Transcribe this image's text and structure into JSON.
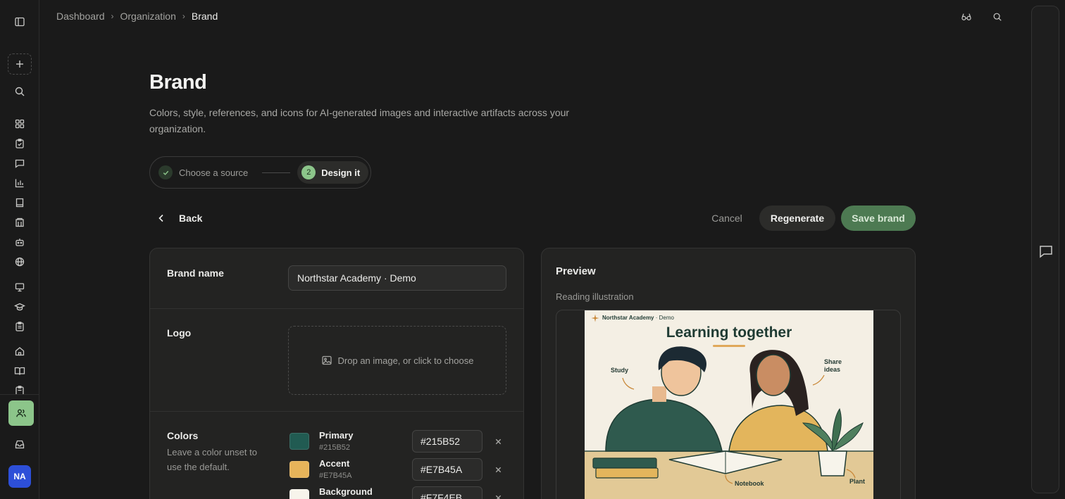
{
  "app": {
    "avatar_initials": "NA"
  },
  "colors": {
    "accent_green": "#8cc58a",
    "save_green": "#4d7a52",
    "avatar_blue": "#2d4fd8"
  },
  "rail": {
    "icons": [
      "sidebar-toggle-icon",
      "plus-icon",
      "search-icon",
      "dashboard-icon",
      "clipboard-icon",
      "chat-icon",
      "chart-icon",
      "book-icon",
      "building-icon",
      "bot-icon",
      "globe-icon",
      "presentation-icon",
      "graduation-cap-icon",
      "clipboard-list-icon",
      "home-icon",
      "open-book-icon",
      "users-icon",
      "inbox-icon"
    ]
  },
  "breadcrumb": {
    "items": [
      "Dashboard",
      "Organization"
    ],
    "current": "Brand"
  },
  "page": {
    "title": "Brand",
    "subtitle": "Colors, style, references, and icons for AI-generated images and interactive artifacts across your organization."
  },
  "stepper": {
    "step1": "Choose a source",
    "step2_number": "2",
    "step2": "Design it"
  },
  "actions": {
    "back": "Back",
    "cancel": "Cancel",
    "regenerate": "Regenerate",
    "save": "Save brand"
  },
  "form": {
    "brand_name_label": "Brand name",
    "brand_name_value": "Northstar Academy · Demo",
    "logo_label": "Logo",
    "logo_drop_text": "Drop an image, or click to choose",
    "colors_label": "Colors",
    "colors_desc": "Leave a color unset to use the default.",
    "colors": [
      {
        "name": "Primary",
        "hex": "#215B52"
      },
      {
        "name": "Accent",
        "hex": "#E7B45A"
      },
      {
        "name": "Background",
        "hex": "#F7F4EB"
      }
    ]
  },
  "preview": {
    "title": "Preview",
    "subtitle": "Reading illustration",
    "illustration": {
      "brand_name": "Northstar Academy",
      "brand_suffix": "· Demo",
      "headline": "Learning together",
      "labels": {
        "study": "Study",
        "share_line1": "Share",
        "share_line2": "ideas",
        "notebook": "Notebook",
        "plant": "Plant"
      }
    }
  }
}
